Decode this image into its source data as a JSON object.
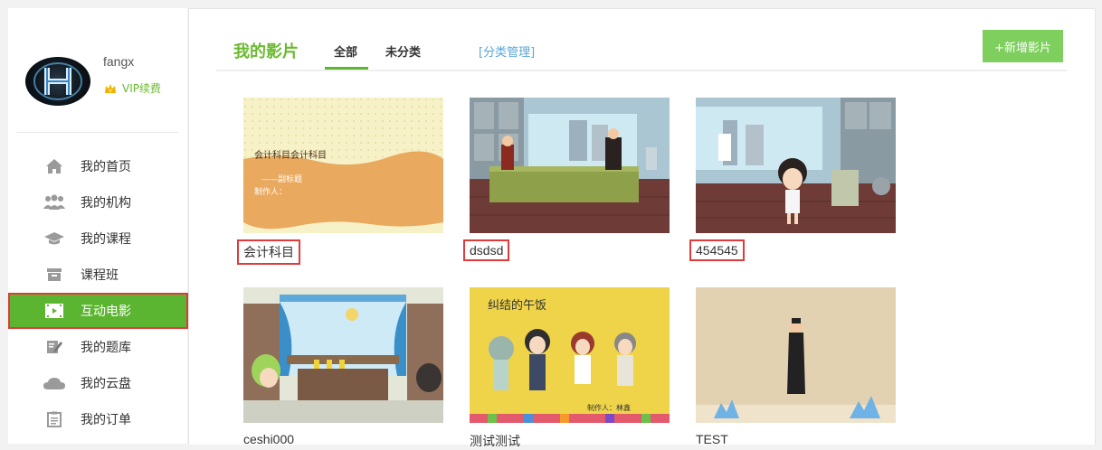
{
  "user": {
    "name": "fangx",
    "vip_label": "VIP续费"
  },
  "sidebar": {
    "items": [
      {
        "label": "我的首页",
        "icon": "home-icon"
      },
      {
        "label": "我的机构",
        "icon": "group-icon"
      },
      {
        "label": "我的课程",
        "icon": "graduation-cap-icon"
      },
      {
        "label": "课程班",
        "icon": "archive-box-icon"
      },
      {
        "label": "互动电影",
        "icon": "film-icon",
        "active": true
      },
      {
        "label": "我的题库",
        "icon": "edit-icon"
      },
      {
        "label": "我的云盘",
        "icon": "cloud-icon"
      },
      {
        "label": "我的订单",
        "icon": "clipboard-icon"
      }
    ]
  },
  "header": {
    "title": "我的影片",
    "tabs": [
      {
        "label": "全部",
        "active": true
      },
      {
        "label": "未分类"
      }
    ],
    "category_link": "[分类管理]",
    "add_button": "+新增影片"
  },
  "films": [
    {
      "title": "会计科目",
      "highlighted": true,
      "thumb_lines": [
        "会计科目会计科目",
        "——副标题",
        "制作人："
      ]
    },
    {
      "title": "dsdsd",
      "highlighted": true
    },
    {
      "title": "454545",
      "highlighted": true
    },
    {
      "title": "ceshi000"
    },
    {
      "title": "测试测试",
      "thumb_lines": [
        "纠结的午饭",
        "制作人：林鑫"
      ]
    },
    {
      "title": "TEST"
    }
  ]
}
